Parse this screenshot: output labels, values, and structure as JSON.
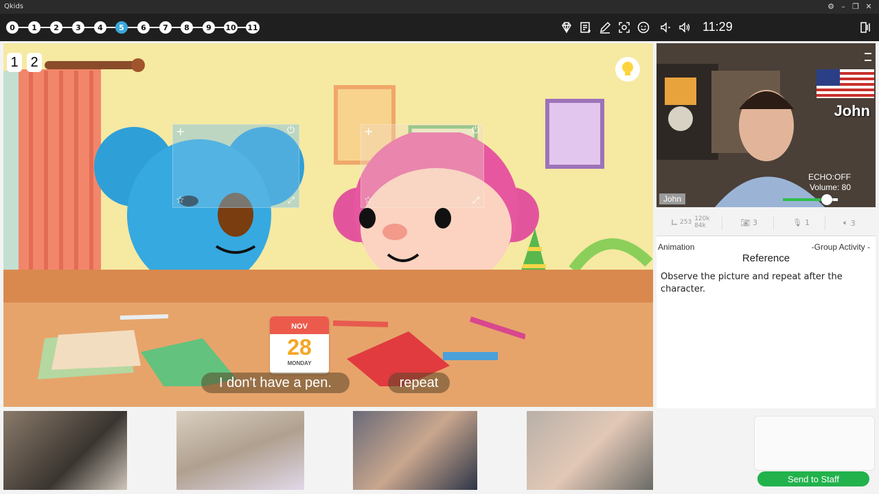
{
  "window": {
    "app_name": "Qkids"
  },
  "pages": {
    "items": [
      "0",
      "1",
      "2",
      "3",
      "4",
      "5",
      "6",
      "7",
      "8",
      "9",
      "10",
      "11"
    ],
    "active": "5"
  },
  "toolbar": {
    "tools": [
      "diamond-icon",
      "whiteboard-icon",
      "pen-icon",
      "screenshot-icon",
      "emoji-icon",
      "speaker-low-icon",
      "speaker-high-icon"
    ],
    "clock": "11:29"
  },
  "stage": {
    "page_tabs": [
      "1",
      "2"
    ],
    "subtitle_1": "I don't have a pen.",
    "subtitle_2": "repeat",
    "calendar_month": "NOV",
    "calendar_day": "28",
    "calendar_weekday": "MONDAY"
  },
  "teacher": {
    "name": "John",
    "name_tag": "John",
    "echo": "ECHO:OFF",
    "volume_label": "Volume: 80",
    "volume": 80
  },
  "stats": {
    "net_a": "253",
    "net_b": "120k",
    "net_c": "84k",
    "camera_count": "3",
    "mic_count": "1",
    "speaker_count": "3"
  },
  "panel": {
    "type_label": "Animation",
    "activity_label": "-Group Activity -",
    "heading": "Reference",
    "description": "Observe the picture and repeat after the character."
  },
  "actions": {
    "send_label": "Send to Staff"
  },
  "colors": {
    "accent": "#3aa7d9",
    "send": "#22b24c",
    "volume": "#2fbf4a"
  }
}
